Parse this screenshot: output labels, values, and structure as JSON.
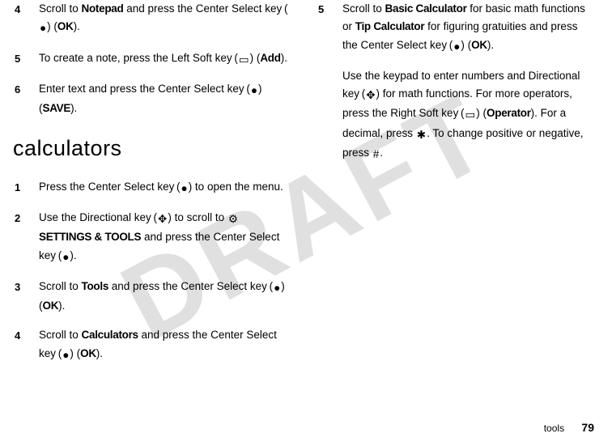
{
  "watermark": "DRAFT",
  "left": {
    "steps_a": [
      {
        "n": "4",
        "html": "Scroll to <span class='cond'>Notepad</span> and press the Center Select key (<span class='icon' data-name='center-select-icon' data-interactable='false'>●</span>) (<span class='cond'>OK</span>)."
      },
      {
        "n": "5",
        "html": "To create a note, press the Left Soft key (<span class='icon' data-name='left-soft-key-icon' data-interactable='false'>▭</span>) (<span class='cond'>Add</span>)."
      },
      {
        "n": "6",
        "html": "Enter text and press the Center Select key (<span class='icon' data-name='center-select-icon' data-interactable='false'>●</span>) (<span class='cond'>SAVE</span>)."
      }
    ],
    "heading": "calculators",
    "steps_b": [
      {
        "n": "1",
        "html": "Press the Center Select key (<span class='icon' data-name='center-select-icon' data-interactable='false'>●</span>) to open the menu."
      },
      {
        "n": "2",
        "html": "Use the Directional key (<span class='icon' data-name='directional-key-icon' data-interactable='false'>✥</span>) to scroll to <span class='icon' data-name='settings-tools-icon' data-interactable='false'>⚙</span> <span class='cond'>SETTINGS &amp; TOOLS</span> and press the Center Select key (<span class='icon' data-name='center-select-icon' data-interactable='false'>●</span>)."
      },
      {
        "n": "3",
        "html": "Scroll to <span class='cond'>Tools</span> and press the Center Select key (<span class='icon' data-name='center-select-icon' data-interactable='false'>●</span>) (<span class='cond'>OK</span>)."
      },
      {
        "n": "4",
        "html": "Scroll to <span class='cond'>Calculators</span> and press the Center Select key (<span class='icon' data-name='center-select-icon' data-interactable='false'>●</span>) (<span class='cond'>OK</span>)."
      }
    ]
  },
  "right": {
    "steps": [
      {
        "n": "5",
        "html": "Scroll to <span class='cond'>Basic Calculator</span> for basic math functions or <span class='cond'>Tip Calculator</span> for figuring gratuities and press the Center Select key (<span class='icon' data-name='center-select-icon' data-interactable='false'>●</span>) (<span class='cond'>OK</span>)."
      }
    ],
    "para_html": "Use the keypad to enter numbers and Directional key (<span class='icon' data-name='directional-key-icon' data-interactable='false'>✥</span>) for math functions. For more operators, press the Right Soft key (<span class='icon' data-name='right-soft-key-icon' data-interactable='false'>▭</span>) (<span class='cond'>Operator</span>). For a decimal, press <span class='icon' data-name='star-key-icon' data-interactable='false'>✱</span>. To change positive or negative, press <span class='icon' data-name='hash-key-icon' data-interactable='false'>#</span>."
  },
  "footer": {
    "section": "tools",
    "page": "79"
  }
}
